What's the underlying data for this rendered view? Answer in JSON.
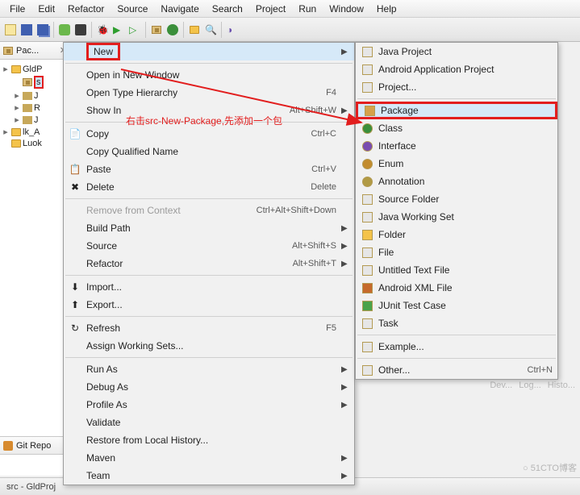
{
  "menubar": [
    "File",
    "Edit",
    "Refactor",
    "Source",
    "Navigate",
    "Search",
    "Project",
    "Run",
    "Window",
    "Help"
  ],
  "leftpane": {
    "tab_label": "Pac...",
    "tree": [
      {
        "twisty": "▸",
        "icon": "project",
        "label": "GldP"
      },
      {
        "twisty": "",
        "icon": "src",
        "label": "s",
        "selected": true,
        "redbox": true,
        "indent": 1
      },
      {
        "twisty": "▸",
        "icon": "jar",
        "label": "J",
        "indent": 1
      },
      {
        "twisty": "▸",
        "icon": "jar",
        "label": "R",
        "indent": 1
      },
      {
        "twisty": "▸",
        "icon": "jar",
        "label": "J",
        "indent": 1
      },
      {
        "twisty": "▸",
        "icon": "project",
        "label": "lk_A"
      },
      {
        "twisty": "",
        "icon": "project",
        "label": "Luok"
      }
    ]
  },
  "gitrepo_label": "Git Repo",
  "annotation_text": "右击src-New-Package,先添加一个包",
  "context_menu": [
    {
      "type": "item",
      "label": "New",
      "shortcut": "",
      "has_sub": true,
      "highlight": true,
      "boxed": true
    },
    {
      "type": "sep"
    },
    {
      "type": "item",
      "label": "Open in New Window"
    },
    {
      "type": "item",
      "label": "Open Type Hierarchy",
      "shortcut": "F4"
    },
    {
      "type": "item",
      "label": "Show In",
      "shortcut": "Alt+Shift+W",
      "has_sub": true
    },
    {
      "type": "sep"
    },
    {
      "type": "item",
      "icon": "copy",
      "label": "Copy",
      "shortcut": "Ctrl+C"
    },
    {
      "type": "item",
      "icon": "copyq",
      "label": "Copy Qualified Name"
    },
    {
      "type": "item",
      "icon": "paste",
      "label": "Paste",
      "shortcut": "Ctrl+V"
    },
    {
      "type": "item",
      "icon": "delete",
      "label": "Delete",
      "shortcut": "Delete"
    },
    {
      "type": "sep"
    },
    {
      "type": "item",
      "label": "Remove from Context",
      "shortcut": "Ctrl+Alt+Shift+Down",
      "disabled": true
    },
    {
      "type": "item",
      "label": "Build Path",
      "has_sub": true
    },
    {
      "type": "item",
      "label": "Source",
      "shortcut": "Alt+Shift+S",
      "has_sub": true
    },
    {
      "type": "item",
      "label": "Refactor",
      "shortcut": "Alt+Shift+T",
      "has_sub": true
    },
    {
      "type": "sep"
    },
    {
      "type": "item",
      "icon": "import",
      "label": "Import..."
    },
    {
      "type": "item",
      "icon": "export",
      "label": "Export..."
    },
    {
      "type": "sep"
    },
    {
      "type": "item",
      "icon": "refresh",
      "label": "Refresh",
      "shortcut": "F5"
    },
    {
      "type": "item",
      "label": "Assign Working Sets..."
    },
    {
      "type": "sep"
    },
    {
      "type": "item",
      "label": "Run As",
      "has_sub": true
    },
    {
      "type": "item",
      "label": "Debug As",
      "has_sub": true
    },
    {
      "type": "item",
      "label": "Profile As",
      "has_sub": true
    },
    {
      "type": "item",
      "label": "Validate"
    },
    {
      "type": "item",
      "label": "Restore from Local History..."
    },
    {
      "type": "item",
      "label": "Maven",
      "has_sub": true
    },
    {
      "type": "item",
      "label": "Team",
      "has_sub": true
    }
  ],
  "submenu": [
    {
      "type": "item",
      "icon": "jproj",
      "label": "Java Project"
    },
    {
      "type": "item",
      "icon": "android",
      "label": "Android Application Project"
    },
    {
      "type": "item",
      "icon": "proj",
      "label": "Project..."
    },
    {
      "type": "sep"
    },
    {
      "type": "item",
      "icon": "pkg",
      "label": "Package",
      "highlight": true,
      "boxed": true
    },
    {
      "type": "item",
      "icon": "class",
      "label": "Class"
    },
    {
      "type": "item",
      "icon": "iface",
      "label": "Interface"
    },
    {
      "type": "item",
      "icon": "enum",
      "label": "Enum"
    },
    {
      "type": "item",
      "icon": "anno",
      "label": "Annotation"
    },
    {
      "type": "item",
      "icon": "srcfolder",
      "label": "Source Folder"
    },
    {
      "type": "item",
      "icon": "ws",
      "label": "Java Working Set"
    },
    {
      "type": "item",
      "icon": "folder",
      "label": "Folder"
    },
    {
      "type": "item",
      "icon": "file",
      "label": "File"
    },
    {
      "type": "item",
      "icon": "txt",
      "label": "Untitled Text File"
    },
    {
      "type": "item",
      "icon": "xml",
      "label": "Android XML File"
    },
    {
      "type": "item",
      "icon": "junit",
      "label": "JUnit Test Case"
    },
    {
      "type": "item",
      "icon": "task",
      "label": "Task"
    },
    {
      "type": "sep"
    },
    {
      "type": "item",
      "icon": "example",
      "label": "Example..."
    },
    {
      "type": "sep"
    },
    {
      "type": "item",
      "icon": "other",
      "label": "Other...",
      "shortcut": "Ctrl+N"
    }
  ],
  "right_tabs": [
    "Dev...",
    "Log...",
    "Histo..."
  ],
  "status_text": "src - GldProj",
  "watermark": "○ 51CTO博客",
  "icons": {
    "pkg": "#d6a24a",
    "folder": "#f4c34a",
    "java": "#5b7bb4",
    "class": "#3b8f3b",
    "iface": "#7a4db0",
    "enum": "#c28c2e",
    "anno": "#b19a45",
    "junit": "#4aa24a",
    "xml": "#c56a2c",
    "file": "#e6e6e6",
    "copy": "📄",
    "paste": "📋",
    "delete": "✖",
    "refresh": "↻",
    "import": "⬇",
    "export": "⬆"
  }
}
